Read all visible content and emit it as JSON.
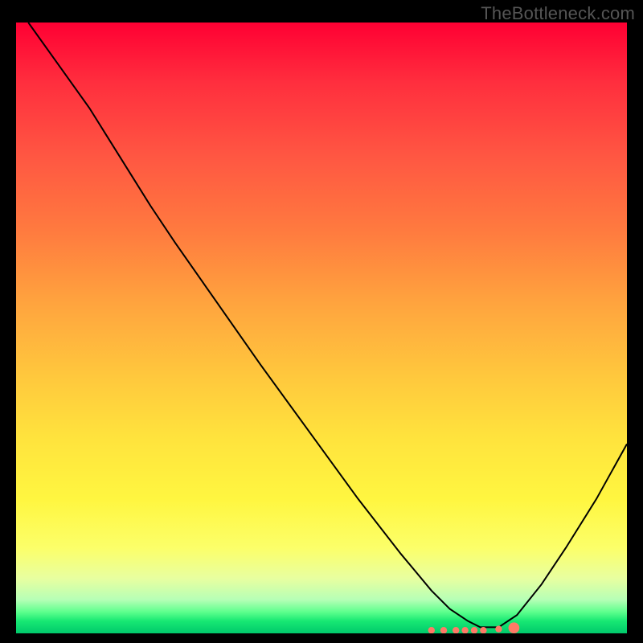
{
  "watermark": "TheBottleneck.com",
  "chart_data": {
    "type": "line",
    "title": "",
    "xlabel": "",
    "ylabel": "",
    "xlim": [
      0,
      100
    ],
    "ylim": [
      0,
      100
    ],
    "grid": false,
    "background_gradient": {
      "stops": [
        {
          "pct": 0,
          "color": "#ff0033"
        },
        {
          "pct": 10,
          "color": "#ff2f3e"
        },
        {
          "pct": 22,
          "color": "#ff5742"
        },
        {
          "pct": 34,
          "color": "#ff7a3f"
        },
        {
          "pct": 46,
          "color": "#ffa43e"
        },
        {
          "pct": 58,
          "color": "#ffc83d"
        },
        {
          "pct": 68,
          "color": "#ffe33d"
        },
        {
          "pct": 78,
          "color": "#fff640"
        },
        {
          "pct": 86,
          "color": "#fcff69"
        },
        {
          "pct": 91,
          "color": "#e8ffa0"
        },
        {
          "pct": 94.5,
          "color": "#b6ffb6"
        },
        {
          "pct": 96.5,
          "color": "#5dff8d"
        },
        {
          "pct": 98,
          "color": "#17e873"
        },
        {
          "pct": 100,
          "color": "#00c96b"
        }
      ]
    },
    "series": [
      {
        "name": "bottleneck-curve",
        "color": "#000000",
        "x": [
          2,
          7,
          12,
          17,
          22,
          26,
          33,
          40,
          48,
          56,
          63,
          68,
          71,
          74,
          76,
          79,
          82,
          86,
          90,
          95,
          100
        ],
        "values": [
          100,
          93,
          86,
          78,
          70,
          64,
          54,
          44,
          33,
          22,
          13,
          7,
          4,
          2,
          1,
          1,
          3,
          8,
          14,
          22,
          31
        ]
      }
    ],
    "markers": {
      "name": "bottom-dots",
      "color": "#ff7a66",
      "x": [
        68,
        70,
        72,
        73.5,
        75,
        76.5,
        79,
        81.5
      ],
      "y": [
        0.5,
        0.5,
        0.5,
        0.5,
        0.5,
        0.5,
        0.7,
        0.9
      ]
    }
  }
}
